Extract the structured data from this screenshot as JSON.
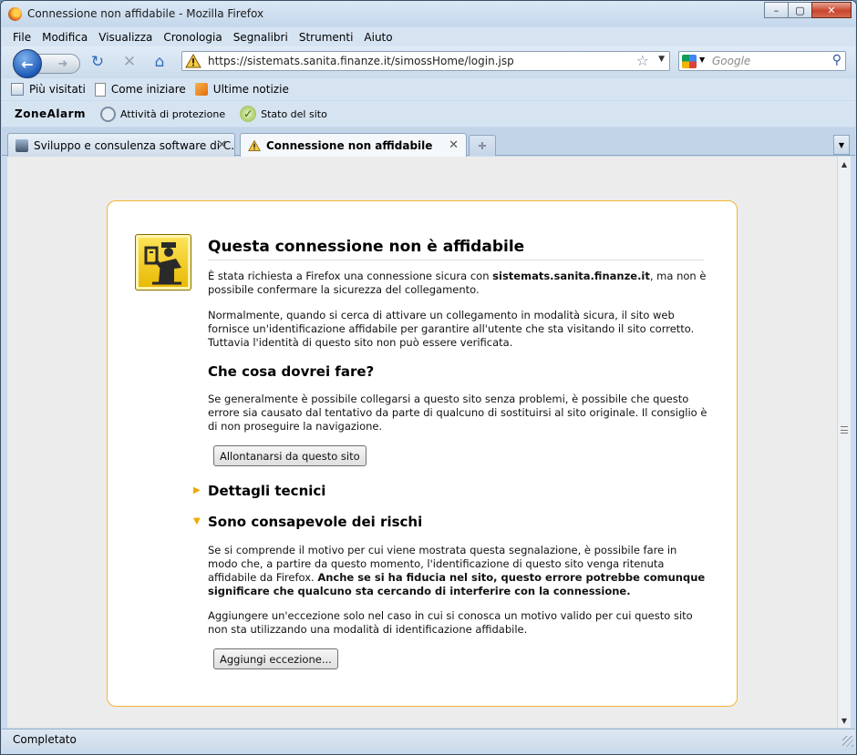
{
  "window": {
    "title": "Connessione non affidabile - Mozilla Firefox",
    "controls": [
      "–",
      "▢",
      "✕"
    ]
  },
  "menubar": {
    "items": [
      {
        "label": "File"
      },
      {
        "label": "Modifica"
      },
      {
        "label": "Visualizza"
      },
      {
        "label": "Cronologia"
      },
      {
        "label": "Segnalibri"
      },
      {
        "label": "Strumenti"
      },
      {
        "label": "Aiuto"
      }
    ]
  },
  "navbar": {
    "url": "https://sistemats.sanita.finanze.it/simossHome/login.jsp",
    "search_placeholder": "Google"
  },
  "bookmarks": {
    "items": [
      {
        "label": "Più visitati"
      },
      {
        "label": "Come iniziare"
      },
      {
        "label": "Ultime notizie"
      }
    ]
  },
  "zonealarm": {
    "logo": "ZoneAlarm",
    "items": [
      {
        "label": "Attività di protezione"
      },
      {
        "label": "Stato del sito"
      }
    ]
  },
  "tabs": [
    {
      "label": "Sviluppo e consulenza software di C...",
      "active": false
    },
    {
      "label": "Connessione non affidabile",
      "active": true
    }
  ],
  "error": {
    "title": "Questa connessione non è affidabile",
    "intro_pre": "È stata richiesta a Firefox una connessione sicura con ",
    "intro_host": "sistemats.sanita.finanze.it",
    "intro_post": ", ma non è possibile confermare la sicurezza del collegamento.",
    "normally": "Normalmente, quando si cerca di attivare un collegamento in modalità sicura, il sito web fornisce un'identificazione affidabile per garantire all'utente che sta visitando il sito corretto. Tuttavia l'identità di questo sito non può essere verificata.",
    "what_heading": "Che cosa dovrei fare?",
    "what_text": "Se generalmente è possibile collegarsi a questo sito senza problemi, è possibile che questo errore sia causato dal tentativo da parte di qualcuno di sostituirsi al sito originale. Il consiglio è di non proseguire la navigazione.",
    "leave_button": "Allontanarsi da questo sito",
    "tech_heading": "Dettagli tecnici",
    "risk_heading": "Sono consapevole dei rischi",
    "risk_text_plain": "Se si comprende il motivo per cui viene mostrata questa segnalazione, è possibile fare in modo che, a partire da questo momento, l'identificazione di questo sito venga ritenuta affidabile da Firefox. ",
    "risk_text_bold": "Anche se si ha fiducia nel sito, questo errore potrebbe comunque significare che qualcuno sta cercando di interferire con la connessione.",
    "exception_text": "Aggiungere un'eccezione solo nel caso in cui si conosca un motivo valido per cui questo sito non sta utilizzando una modalità di identificazione affidabile.",
    "add_exception_button": "Aggiungi eccezione..."
  },
  "status": {
    "text": "Completato"
  },
  "colors": {
    "error_border": "#f2b631",
    "expander": "#f0a800"
  }
}
